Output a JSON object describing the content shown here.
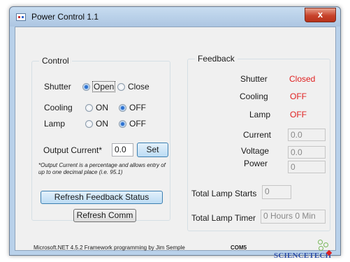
{
  "window": {
    "title": "Power Control 1.1",
    "close_glyph": "x"
  },
  "control": {
    "title": "Control",
    "shutter": {
      "label": "Shutter",
      "options": [
        "Open",
        "Close"
      ],
      "selected": "Open"
    },
    "cooling": {
      "label": "Cooling",
      "options": [
        "ON",
        "OFF"
      ],
      "selected": "OFF"
    },
    "lamp": {
      "label": "Lamp",
      "options": [
        "ON",
        "OFF"
      ],
      "selected": "OFF"
    },
    "output_current": {
      "label": "Output Current*",
      "value": "0.0",
      "set_label": "Set"
    },
    "note": "*Output Current is a percentage and allows entry of up to one decimal place (i.e. 95.1)",
    "refresh_feedback_label": "Refresh Feedback Status",
    "refresh_comm_label": "Refresh Comm"
  },
  "feedback": {
    "title": "Feedback",
    "shutter": {
      "label": "Shutter",
      "value": "Closed"
    },
    "cooling": {
      "label": "Cooling",
      "value": "OFF"
    },
    "lamp": {
      "label": "Lamp",
      "value": "OFF"
    },
    "current": {
      "label": "Current",
      "value": "0.0"
    },
    "voltage": {
      "label": "Voltage",
      "value": "0.0"
    },
    "power": {
      "label": "Power",
      "value": "0"
    },
    "lamp_starts": {
      "label": "Total Lamp Starts",
      "value": "0"
    },
    "lamp_timer": {
      "label": "Total Lamp Timer",
      "value": "0 Hours 0 Min"
    }
  },
  "footer": {
    "credit": "Microsoft.NET 4.5.2 Framework programming by Jim Semple",
    "port": "COM5",
    "logo_text": "SCIENCETECH"
  },
  "colors": {
    "status_red": "#e02020",
    "button_blue": "#bcdcf4",
    "logo_blue": "#2d4ea8"
  }
}
